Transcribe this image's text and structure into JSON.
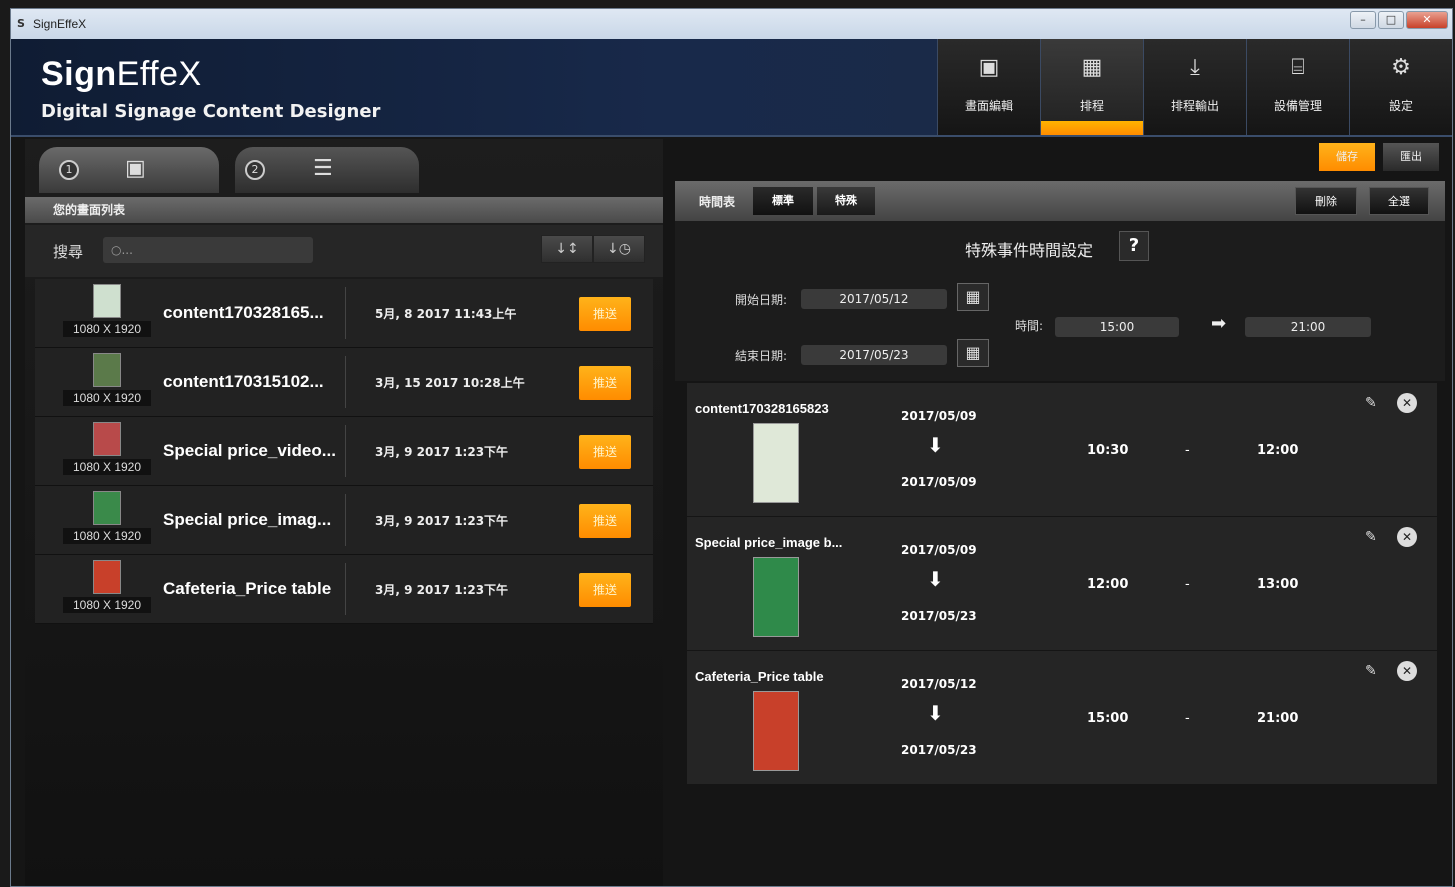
{
  "window": {
    "title": "SignEffeX",
    "app_icon": "S"
  },
  "header": {
    "brand_bold": "Sign",
    "brand_light": "EffeX",
    "subtitle": "Digital Signage Content Designer",
    "nav": [
      {
        "label": "畫面編輯",
        "icon": "image-edit-icon",
        "glyph": "▣"
      },
      {
        "label": "排程",
        "icon": "calendar-icon",
        "glyph": "▦"
      },
      {
        "label": "排程輸出",
        "icon": "download-icon",
        "glyph": "⤓"
      },
      {
        "label": "設備管理",
        "icon": "router-icon",
        "glyph": "⌸"
      },
      {
        "label": "設定",
        "icon": "gear-icon",
        "glyph": "⚙"
      }
    ]
  },
  "left": {
    "tabs": [
      {
        "num": "1",
        "glyph": "▣"
      },
      {
        "num": "2",
        "glyph": "☰"
      }
    ],
    "list_title": "您的畫面列表",
    "search_label": "搜尋",
    "search_placeholder": "○...",
    "sort_glyphs": [
      "↓↕",
      "↓◷"
    ],
    "items": [
      {
        "name": "content170328165...",
        "res": "1080 X 1920",
        "date": "5月, 8 2017 11:43上午",
        "push": "推送",
        "thumb_color": "#cfe0cf"
      },
      {
        "name": "content170315102...",
        "res": "1080 X 1920",
        "date": "3月, 15 2017 10:28上午",
        "push": "推送",
        "thumb_color": "#5b7a4a"
      },
      {
        "name": "Special price_video...",
        "res": "1080 X 1920",
        "date": "3月, 9 2017 1:23下午",
        "push": "推送",
        "thumb_color": "#b84a4a"
      },
      {
        "name": "Special price_imag...",
        "res": "1080 X 1920",
        "date": "3月, 9 2017 1:23下午",
        "push": "推送",
        "thumb_color": "#3a8a4a"
      },
      {
        "name": "Cafeteria_Price table",
        "res": "1080 X 1920",
        "date": "3月, 9 2017 1:23下午",
        "push": "推送",
        "thumb_color": "#c8402a"
      }
    ]
  },
  "right": {
    "top_actions": [
      "儲存",
      "匯出"
    ],
    "header_title": "時間表",
    "header_tabs": [
      "標準",
      "特殊"
    ],
    "header_btns": [
      "刪除",
      "全選"
    ],
    "schedule": {
      "title": "特殊事件時間設定",
      "help": "?",
      "start_label": "開始日期:",
      "start_date": "2017/05/12",
      "end_label": "結束日期:",
      "end_date": "2017/05/23",
      "time_label": "時間:",
      "time_from": "15:00",
      "time_to": "21:00"
    },
    "events": [
      {
        "name": "content170328165823",
        "d1": "2017/05/09",
        "d2": "2017/05/09",
        "t1": "10:30",
        "t2": "12:00",
        "thumb_color": "#dfe8d8"
      },
      {
        "name": "Special price_image b...",
        "d1": "2017/05/09",
        "d2": "2017/05/23",
        "t1": "12:00",
        "t2": "13:00",
        "thumb_color": "#2f8a4a"
      },
      {
        "name": "Cafeteria_Price table",
        "d1": "2017/05/12",
        "d2": "2017/05/23",
        "t1": "15:00",
        "t2": "21:00",
        "thumb_color": "#c8402a"
      }
    ]
  },
  "colors": {
    "accent": "#ff9a00",
    "header_bg": "#18294a",
    "panel": "#222222"
  }
}
